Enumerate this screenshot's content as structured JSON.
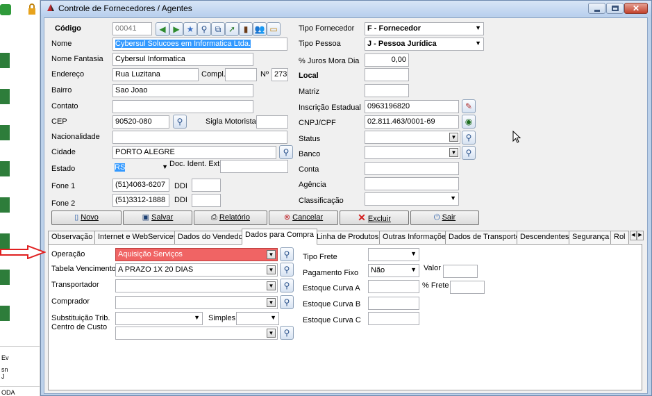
{
  "desktop": {
    "items": [
      "Ev",
      "sn",
      "J",
      "ODA"
    ]
  },
  "window": {
    "title": "Controle de Fornecedores / Agentes"
  },
  "form": {
    "codigo": {
      "label": "Código",
      "value": "00041"
    },
    "nome": {
      "label": "Nome",
      "value": "Cybersul Solucoes em Informatica Ltda."
    },
    "nome_fantasia": {
      "label": "Nome Fantasia",
      "value": "Cybersul Informatica"
    },
    "endereco": {
      "label": "Endereço",
      "value": "Rua Luzitana",
      "compl_label": "Compl.",
      "compl_value": "",
      "num_label": "Nº",
      "num_value": "273"
    },
    "bairro": {
      "label": "Bairro",
      "value": "Sao Joao"
    },
    "contato": {
      "label": "Contato",
      "value": ""
    },
    "cep": {
      "label": "CEP",
      "value": "90520-080",
      "sigla_label": "Sigla Motorista",
      "sigla_value": ""
    },
    "nacionalidade": {
      "label": "Nacionalidade",
      "value": ""
    },
    "cidade": {
      "label": "Cidade",
      "value": "PORTO ALEGRE"
    },
    "estado": {
      "label": "Estado",
      "value": "RS",
      "doc_label": "Doc. Ident. Ext.",
      "doc_value": ""
    },
    "fone1": {
      "label": "Fone 1",
      "value": "(51)4063-6207",
      "ddi_label": "DDI",
      "ddi_value": ""
    },
    "fone2": {
      "label": "Fone 2",
      "value": "(51)3312-1888",
      "ddi_label": "DDI",
      "ddi_value": ""
    },
    "tipo_fornecedor": {
      "label": "Tipo Fornecedor",
      "value": "F - Fornecedor"
    },
    "tipo_pessoa": {
      "label": "Tipo Pessoa",
      "value": "J - Pessoa Jurídica"
    },
    "juros": {
      "label": "% Juros Mora Dia",
      "value": "0,00"
    },
    "local": {
      "label": "Local",
      "value": ""
    },
    "matriz": {
      "label": "Matriz",
      "value": ""
    },
    "inscricao": {
      "label": "Inscrição Estadual",
      "value": "0963196820"
    },
    "cnpj": {
      "label": "CNPJ/CPF",
      "value": "02.811.463/0001-69"
    },
    "status": {
      "label": "Status",
      "value": ""
    },
    "banco": {
      "label": "Banco",
      "value": ""
    },
    "conta": {
      "label": "Conta",
      "value": ""
    },
    "agencia": {
      "label": "Agência",
      "value": ""
    },
    "classificacao": {
      "label": "Classificação",
      "value": ""
    }
  },
  "actions": {
    "novo": "Novo",
    "salvar": "Salvar",
    "relatorio": "Relatório",
    "cancelar": "Cancelar",
    "excluir": "Excluir",
    "sair": "Sair"
  },
  "tabs": [
    "Observação",
    "Internet e WebServices",
    "Dados do Vendedor",
    "Dados para Compra",
    "Linha de Produtos",
    "Outras Informações",
    "Dados de Transporte",
    "Descendentes",
    "Segurança",
    "Rol"
  ],
  "compra": {
    "operacao": {
      "label": "Operação",
      "value": "Aquisição Serviços"
    },
    "tabela_vencimento": {
      "label": "Tabela Vencimento",
      "value": "A PRAZO  1X 20 DIAS"
    },
    "transportador": {
      "label": "Transportador",
      "value": ""
    },
    "comprador": {
      "label": "Comprador",
      "value": ""
    },
    "substituicao": {
      "label": "Substituição Trib.",
      "value": ""
    },
    "simples": {
      "label": "Simples",
      "value": ""
    },
    "centro_custo": {
      "label": "Centro de Custo",
      "value": ""
    },
    "tipo_frete": {
      "label": "Tipo Frete",
      "value": ""
    },
    "pagamento_fixo": {
      "label": "Pagamento Fixo",
      "value": "Não"
    },
    "valor": {
      "label": "Valor",
      "value": ""
    },
    "frete_pct": {
      "label": "% Frete",
      "value": ""
    },
    "curva_a": {
      "label": "Estoque Curva A",
      "value": ""
    },
    "curva_b": {
      "label": "Estoque Curva B",
      "value": ""
    },
    "curva_c": {
      "label": "Estoque Curva C",
      "value": ""
    }
  },
  "colors": {
    "highlight": "#f06464",
    "arrow": "#e02020"
  }
}
